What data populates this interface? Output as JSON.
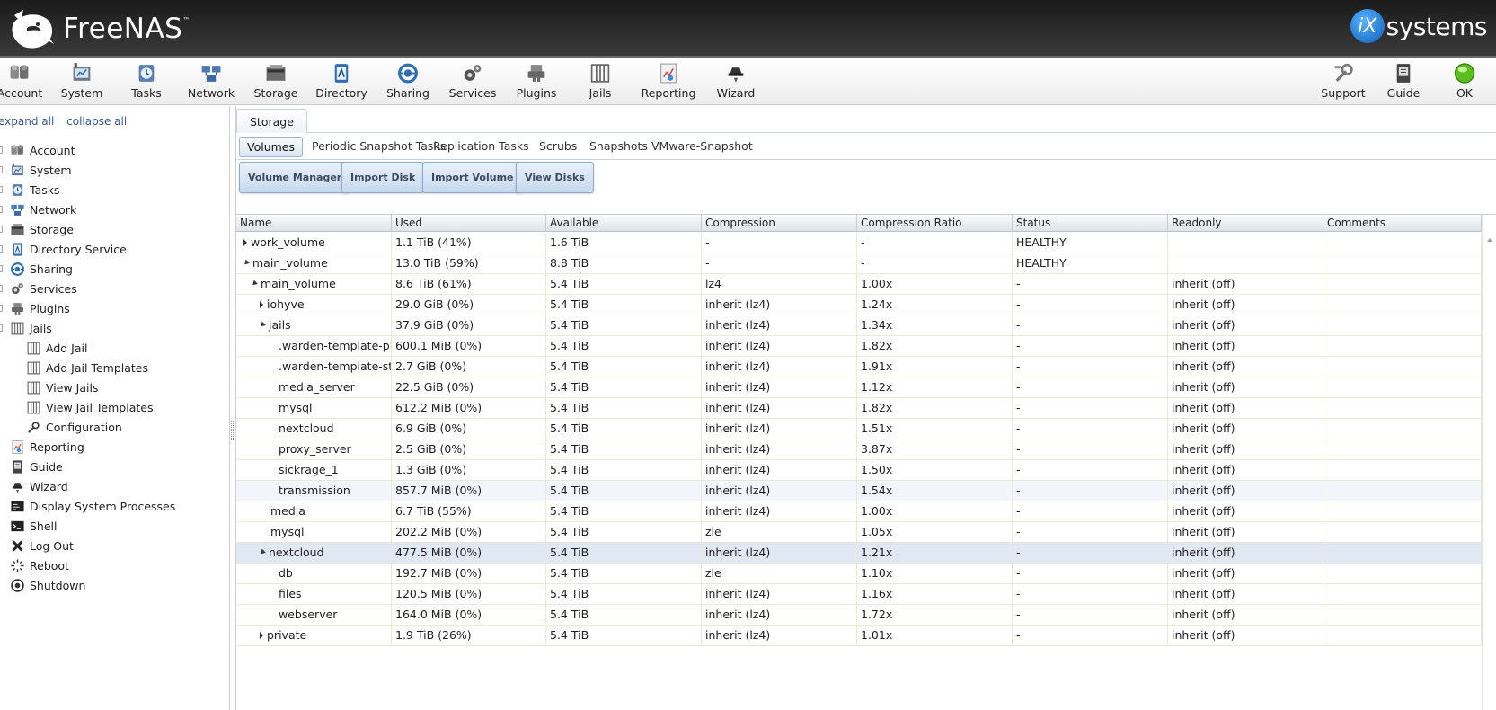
{
  "header": {
    "app_name": "FreeNAS",
    "trademark": "™",
    "brand_mark": "iX",
    "brand_name": "systems"
  },
  "toolbar": {
    "left_items": [
      {
        "label": "Account",
        "icon": "account-icon"
      },
      {
        "label": "System",
        "icon": "system-icon"
      },
      {
        "label": "Tasks",
        "icon": "tasks-icon"
      },
      {
        "label": "Network",
        "icon": "network-icon"
      },
      {
        "label": "Storage",
        "icon": "storage-icon"
      },
      {
        "label": "Directory",
        "icon": "directory-icon"
      },
      {
        "label": "Sharing",
        "icon": "sharing-icon"
      },
      {
        "label": "Services",
        "icon": "services-icon"
      },
      {
        "label": "Plugins",
        "icon": "plugins-icon"
      },
      {
        "label": "Jails",
        "icon": "jails-icon"
      },
      {
        "label": "Reporting",
        "icon": "reporting-icon"
      },
      {
        "label": "Wizard",
        "icon": "wizard-icon"
      }
    ],
    "right_items": [
      {
        "label": "Support",
        "icon": "support-icon"
      },
      {
        "label": "Guide",
        "icon": "guide-icon"
      },
      {
        "label": "OK",
        "icon": "status-ok-icon"
      }
    ]
  },
  "sidebar": {
    "expand_all": "expand all",
    "collapse_all": "collapse all",
    "items": [
      {
        "label": "Account",
        "icon": "account-icon",
        "level": 0
      },
      {
        "label": "System",
        "icon": "system-icon",
        "level": 0
      },
      {
        "label": "Tasks",
        "icon": "tasks-icon",
        "level": 0
      },
      {
        "label": "Network",
        "icon": "network-icon",
        "level": 0
      },
      {
        "label": "Storage",
        "icon": "storage-icon",
        "level": 0
      },
      {
        "label": "Directory Service",
        "icon": "directory-icon",
        "level": 0
      },
      {
        "label": "Sharing",
        "icon": "sharing-icon",
        "level": 0
      },
      {
        "label": "Services",
        "icon": "services-icon",
        "level": 0
      },
      {
        "label": "Plugins",
        "icon": "plugins-icon",
        "level": 0
      },
      {
        "label": "Jails",
        "icon": "jails-icon",
        "level": 0
      },
      {
        "label": "Add Jail",
        "icon": "jails-icon",
        "level": 1
      },
      {
        "label": "Add Jail Templates",
        "icon": "jails-icon",
        "level": 1
      },
      {
        "label": "View Jails",
        "icon": "jails-icon",
        "level": 1
      },
      {
        "label": "View Jail Templates",
        "icon": "jails-icon",
        "level": 1
      },
      {
        "label": "Configuration",
        "icon": "wrench-icon",
        "level": 1
      },
      {
        "label": "Reporting",
        "icon": "reporting-icon",
        "level": 0
      },
      {
        "label": "Guide",
        "icon": "guide-icon",
        "level": 0
      },
      {
        "label": "Wizard",
        "icon": "wizard-icon",
        "level": 0
      },
      {
        "label": "Display System Processes",
        "icon": "processes-icon",
        "level": 0
      },
      {
        "label": "Shell",
        "icon": "shell-icon",
        "level": 0
      },
      {
        "label": "Log Out",
        "icon": "logout-icon",
        "level": 0
      },
      {
        "label": "Reboot",
        "icon": "reboot-icon",
        "level": 0
      },
      {
        "label": "Shutdown",
        "icon": "shutdown-icon",
        "level": 0
      }
    ]
  },
  "main": {
    "tab": "Storage",
    "subtabs": [
      "Volumes",
      "Periodic Snapshot Tasks",
      "Replication Tasks",
      "Scrubs",
      "Snapshots",
      "VMware-Snapshot"
    ],
    "active_subtab": "Volumes",
    "actions": [
      "Volume Manager",
      "Import Disk",
      "Import Volume",
      "View Disks"
    ],
    "columns": [
      "Name",
      "Used",
      "Available",
      "Compression",
      "Compression Ratio",
      "Status",
      "Readonly",
      "Comments"
    ],
    "rows": [
      {
        "indent": 0,
        "expander": "closed",
        "name": "work_volume",
        "used": "1.1 TiB (41%)",
        "available": "1.6 TiB",
        "compression": "-",
        "ratio": "-",
        "status": "HEALTHY",
        "readonly": "",
        "comments": ""
      },
      {
        "indent": 0,
        "expander": "open",
        "name": "main_volume",
        "used": "13.0 TiB (59%)",
        "available": "8.8 TiB",
        "compression": "-",
        "ratio": "-",
        "status": "HEALTHY",
        "readonly": "",
        "comments": ""
      },
      {
        "indent": 1,
        "expander": "open",
        "name": "main_volume",
        "used": "8.6 TiB (61%)",
        "available": "5.4 TiB",
        "compression": "lz4",
        "ratio": "1.00x",
        "status": "-",
        "readonly": "inherit (off)",
        "comments": ""
      },
      {
        "indent": 2,
        "expander": "closed",
        "name": "iohyve",
        "used": "29.0 GiB (0%)",
        "available": "5.4 TiB",
        "compression": "inherit (lz4)",
        "ratio": "1.24x",
        "status": "-",
        "readonly": "inherit (off)",
        "comments": ""
      },
      {
        "indent": 2,
        "expander": "open",
        "name": "jails",
        "used": "37.9 GiB (0%)",
        "available": "5.4 TiB",
        "compression": "inherit (lz4)",
        "ratio": "1.34x",
        "status": "-",
        "readonly": "inherit (off)",
        "comments": ""
      },
      {
        "indent": 3,
        "expander": "none",
        "name": ".warden-template-pluginjail",
        "used": "600.1 MiB (0%)",
        "available": "5.4 TiB",
        "compression": "inherit (lz4)",
        "ratio": "1.82x",
        "status": "-",
        "readonly": "inherit (off)",
        "comments": ""
      },
      {
        "indent": 3,
        "expander": "none",
        "name": ".warden-template-standard",
        "used": "2.7 GiB (0%)",
        "available": "5.4 TiB",
        "compression": "inherit (lz4)",
        "ratio": "1.91x",
        "status": "-",
        "readonly": "inherit (off)",
        "comments": ""
      },
      {
        "indent": 3,
        "expander": "none",
        "name": "media_server",
        "used": "22.5 GiB (0%)",
        "available": "5.4 TiB",
        "compression": "inherit (lz4)",
        "ratio": "1.12x",
        "status": "-",
        "readonly": "inherit (off)",
        "comments": ""
      },
      {
        "indent": 3,
        "expander": "none",
        "name": "mysql",
        "used": "612.2 MiB (0%)",
        "available": "5.4 TiB",
        "compression": "inherit (lz4)",
        "ratio": "1.82x",
        "status": "-",
        "readonly": "inherit (off)",
        "comments": ""
      },
      {
        "indent": 3,
        "expander": "none",
        "name": "nextcloud",
        "used": "6.9 GiB (0%)",
        "available": "5.4 TiB",
        "compression": "inherit (lz4)",
        "ratio": "1.51x",
        "status": "-",
        "readonly": "inherit (off)",
        "comments": ""
      },
      {
        "indent": 3,
        "expander": "none",
        "name": "proxy_server",
        "used": "2.5 GiB (0%)",
        "available": "5.4 TiB",
        "compression": "inherit (lz4)",
        "ratio": "3.87x",
        "status": "-",
        "readonly": "inherit (off)",
        "comments": ""
      },
      {
        "indent": 3,
        "expander": "none",
        "name": "sickrage_1",
        "used": "1.3 GiB (0%)",
        "available": "5.4 TiB",
        "compression": "inherit (lz4)",
        "ratio": "1.50x",
        "status": "-",
        "readonly": "inherit (off)",
        "comments": ""
      },
      {
        "indent": 3,
        "expander": "none",
        "name": "transmission",
        "used": "857.7 MiB (0%)",
        "available": "5.4 TiB",
        "compression": "inherit (lz4)",
        "ratio": "1.54x",
        "status": "-",
        "readonly": "inherit (off)",
        "comments": "",
        "highlight": "light"
      },
      {
        "indent": 2,
        "expander": "none",
        "name": "media",
        "used": "6.7 TiB (55%)",
        "available": "5.4 TiB",
        "compression": "inherit (lz4)",
        "ratio": "1.00x",
        "status": "-",
        "readonly": "inherit (off)",
        "comments": ""
      },
      {
        "indent": 2,
        "expander": "none",
        "name": "mysql",
        "used": "202.2 MiB (0%)",
        "available": "5.4 TiB",
        "compression": "zle",
        "ratio": "1.05x",
        "status": "-",
        "readonly": "inherit (off)",
        "comments": ""
      },
      {
        "indent": 2,
        "expander": "open",
        "name": "nextcloud",
        "used": "477.5 MiB (0%)",
        "available": "5.4 TiB",
        "compression": "inherit (lz4)",
        "ratio": "1.21x",
        "status": "-",
        "readonly": "inherit (off)",
        "comments": "",
        "highlight": "selected"
      },
      {
        "indent": 3,
        "expander": "none",
        "name": "db",
        "used": "192.7 MiB (0%)",
        "available": "5.4 TiB",
        "compression": "zle",
        "ratio": "1.10x",
        "status": "-",
        "readonly": "inherit (off)",
        "comments": ""
      },
      {
        "indent": 3,
        "expander": "none",
        "name": "files",
        "used": "120.5 MiB (0%)",
        "available": "5.4 TiB",
        "compression": "inherit (lz4)",
        "ratio": "1.16x",
        "status": "-",
        "readonly": "inherit (off)",
        "comments": ""
      },
      {
        "indent": 3,
        "expander": "none",
        "name": "webserver",
        "used": "164.0 MiB (0%)",
        "available": "5.4 TiB",
        "compression": "inherit (lz4)",
        "ratio": "1.72x",
        "status": "-",
        "readonly": "inherit (off)",
        "comments": ""
      },
      {
        "indent": 2,
        "expander": "closed",
        "name": "private",
        "used": "1.9 TiB (26%)",
        "available": "5.4 TiB",
        "compression": "inherit (lz4)",
        "ratio": "1.01x",
        "status": "-",
        "readonly": "inherit (off)",
        "comments": ""
      }
    ]
  },
  "colors": {
    "header_bg": "#2a2a2a",
    "accent_blue": "#0a5fb8",
    "selected_row": "#dfe8f3",
    "button_border": "#8eaacb"
  }
}
